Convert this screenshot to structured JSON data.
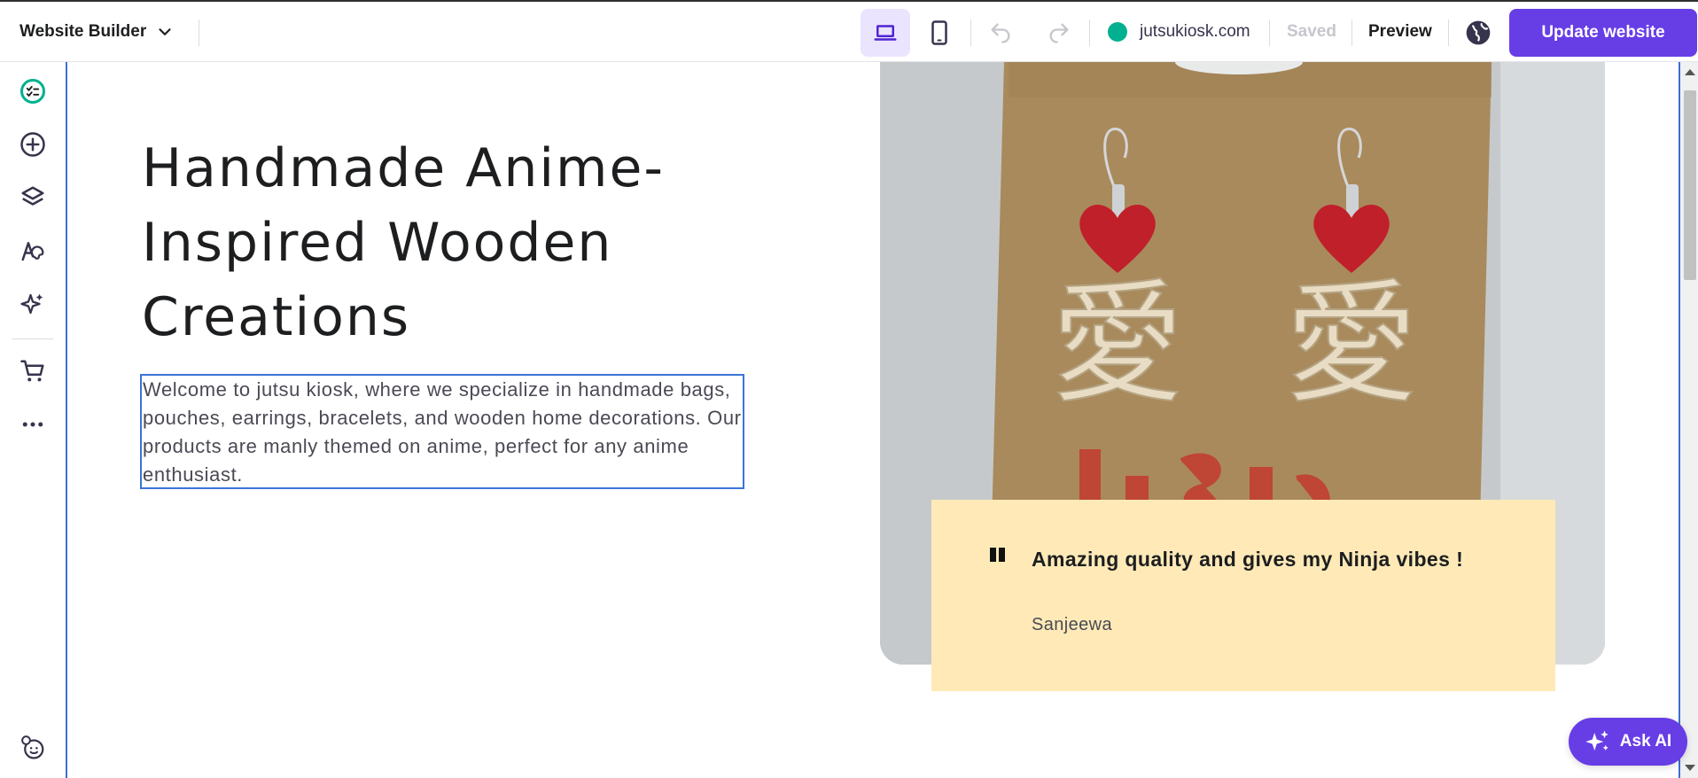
{
  "topbar": {
    "builder_label": "Website Builder",
    "domain": "jutsukiosk.com",
    "saved_label": "Saved",
    "preview_label": "Preview",
    "update_label": "Update website"
  },
  "sidebar": {
    "items": [
      {
        "icon": "checklist-icon"
      },
      {
        "icon": "add-icon"
      },
      {
        "icon": "layers-icon"
      },
      {
        "icon": "design-icon"
      },
      {
        "icon": "ai-tools-icon"
      },
      {
        "icon": "cart-icon"
      },
      {
        "icon": "more-icon"
      },
      {
        "icon": "help-icon"
      }
    ]
  },
  "hero": {
    "title": "Handmade Anime-Inspired Wooden Creations",
    "description": "Welcome to jutsu kiosk, where we specialize in handmade bags, pouches, earrings, bracelets, and wooden home decorations. Our products are manly themed on anime, perfect for any anime enthusiast."
  },
  "review": {
    "text": "Amazing quality and gives my Ninja vibes !",
    "author": "Sanjeewa"
  },
  "ask_ai": {
    "label": "Ask AI"
  },
  "colors": {
    "accent": "#673de6",
    "domain_status": "#00b090",
    "review_bg": "#ffeab7",
    "selection": "#3b74d6"
  }
}
